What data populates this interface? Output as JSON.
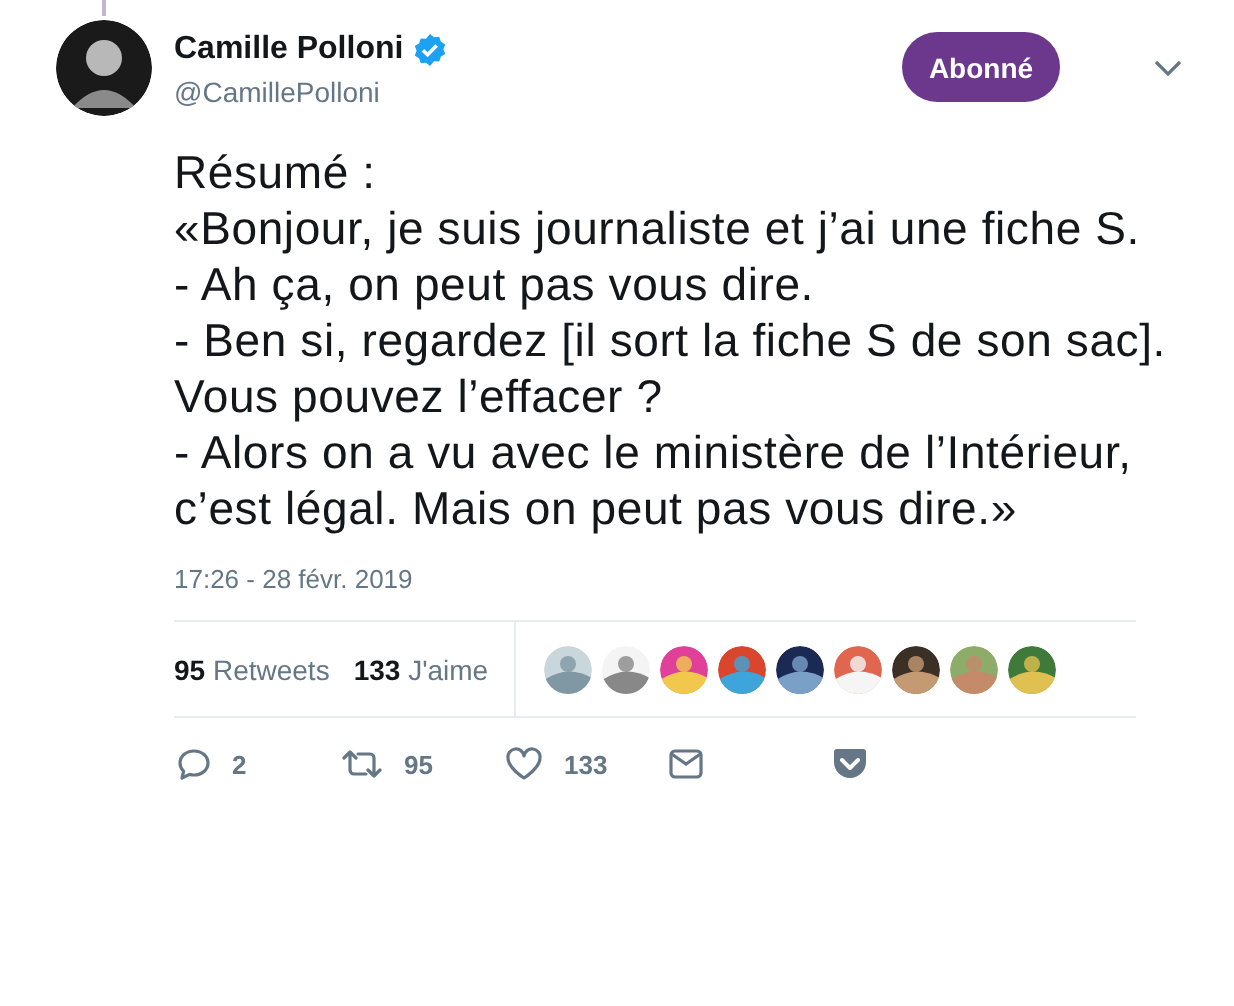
{
  "author": {
    "name": "Camille Polloni",
    "handle": "@CamillePolloni",
    "verified": true
  },
  "follow_button": "Abonné",
  "tweet": {
    "paragraphs": [
      "Résumé :",
      "«Bonjour, je suis journaliste et j’ai une fiche S.",
      "- Ah ça, on peut pas vous dire.",
      "- Ben si, regardez [il sort la fiche S de son sac]. Vous pouvez l’effacer ?",
      "- Alors on a vu avec le ministère de l’Intérieur, c’est légal. Mais on peut pas vous dire.»"
    ]
  },
  "timestamp": "17:26 - 28 févr. 2019",
  "stats": [
    {
      "count": "95",
      "label": "Retweets"
    },
    {
      "count": "133",
      "label": "J'aime"
    }
  ],
  "actions": [
    {
      "kind": "reply",
      "count": "2"
    },
    {
      "kind": "retweet",
      "count": "95"
    },
    {
      "kind": "like",
      "count": "133"
    },
    {
      "kind": "message"
    },
    {
      "kind": "save"
    }
  ]
}
